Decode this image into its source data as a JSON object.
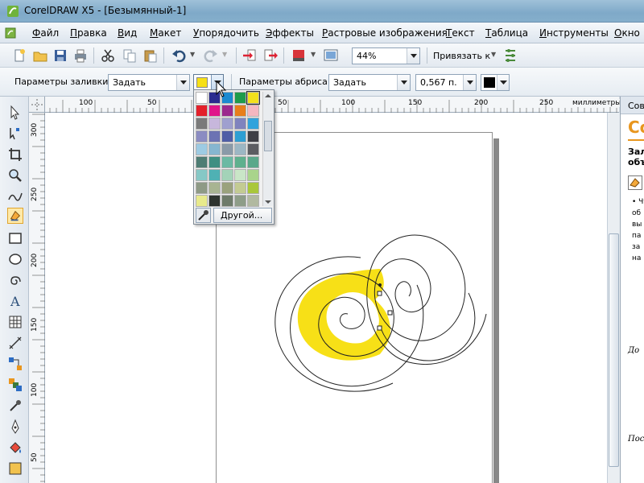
{
  "window": {
    "title": "CorelDRAW X5 - [Безымянный-1]"
  },
  "menu": [
    "Файл",
    "Правка",
    "Вид",
    "Макет",
    "Упорядочить",
    "Эффекты",
    "Растровые изображения",
    "Текст",
    "Таблица",
    "Инструменты",
    "Окно"
  ],
  "toolbar": {
    "zoom": "44%",
    "snap_label": "Привязать к"
  },
  "property_bar": {
    "fill_label": "Параметры заливки:",
    "fill_value": "Задать",
    "fill_color": "#f7e017",
    "outline_label": "Параметры абриса:",
    "outline_value": "Задать",
    "outline_width": "0,567 п.",
    "outline_color": "#000000"
  },
  "rulers": {
    "unit": "миллиметры",
    "top_ticks": [
      "100",
      "50",
      "0",
      "50",
      "100",
      "150",
      "200",
      "250"
    ],
    "left_ticks": [
      "300",
      "250",
      "200",
      "150",
      "100",
      "50"
    ]
  },
  "color_popup": {
    "other_label": "Другой...",
    "swatches": [
      "#ffffff",
      "#2b2c8f",
      "#1a8ad0",
      "#1e9b4a",
      "#f3e01b",
      "#e3202a",
      "#e0168a",
      "#9b2a8e",
      "#e87e1b",
      "#f5b7c0",
      "#7a7a7a",
      "#c7b7dc",
      "#9fa0cf",
      "#7f83be",
      "#31a3dc",
      "#8b8cc2",
      "#6c73b3",
      "#4f5ea6",
      "#2e9fd3",
      "#3e3f45",
      "#9dcbe3",
      "#86b6d0",
      "#8a9aa8",
      "#9cb7c4",
      "#5c5d62",
      "#4e7d74",
      "#3f8f82",
      "#6bb9a3",
      "#5fb08e",
      "#5aa88a",
      "#86c8c6",
      "#4fb1b4",
      "#a3d3b8",
      "#c9e6c7",
      "#a9d48b",
      "#8e9a86",
      "#a8b492",
      "#9aa27d",
      "#c3cb92",
      "#a9c73b",
      "#e8ea8c",
      "#2f3530",
      "#6e7b6a",
      "#8e9d88",
      "#b1b9a0"
    ]
  },
  "docker": {
    "tab": "Сове",
    "heading": "Со",
    "line1": "Зал",
    "line2": "объ",
    "bullets": [
      "Чт",
      "об",
      "вы",
      "па",
      "за",
      "на"
    ],
    "note1": "До",
    "note2": "Посл"
  }
}
